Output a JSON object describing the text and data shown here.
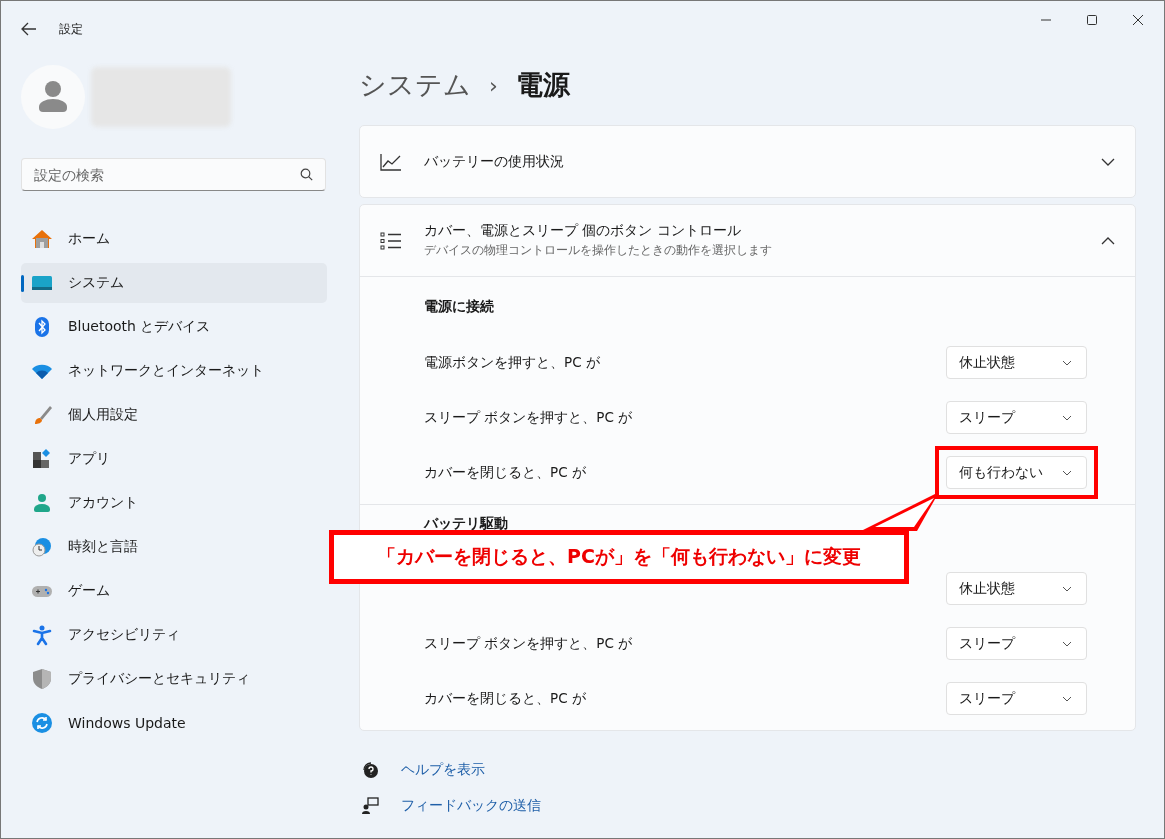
{
  "window": {
    "title": "設定"
  },
  "sidebar": {
    "search": {
      "placeholder": "設定の検索"
    },
    "items": [
      {
        "label": "ホーム",
        "kind": "home",
        "selected": false
      },
      {
        "label": "システム",
        "kind": "system",
        "selected": true
      },
      {
        "label": "Bluetooth とデバイス",
        "kind": "bluetooth",
        "selected": false
      },
      {
        "label": "ネットワークとインターネット",
        "kind": "network",
        "selected": false
      },
      {
        "label": "個人用設定",
        "kind": "brush",
        "selected": false
      },
      {
        "label": "アプリ",
        "kind": "apps",
        "selected": false
      },
      {
        "label": "アカウント",
        "kind": "account",
        "selected": false
      },
      {
        "label": "時刻と言語",
        "kind": "time",
        "selected": false
      },
      {
        "label": "ゲーム",
        "kind": "game",
        "selected": false
      },
      {
        "label": "アクセシビリティ",
        "kind": "access",
        "selected": false
      },
      {
        "label": "プライバシーとセキュリティ",
        "kind": "shield",
        "selected": false
      },
      {
        "label": "Windows Update",
        "kind": "update",
        "selected": false
      }
    ]
  },
  "breadcrumb": {
    "parent": "システム",
    "separator": "›",
    "current": "電源"
  },
  "cards": [
    {
      "title": "バッテリーの使用状況",
      "kind": "chart",
      "expanded": false
    },
    {
      "title": "カバー、電源とスリープ 個のボタン コントロール",
      "subtitle": "デバイスの物理コントロールを操作したときの動作を選択します",
      "kind": "list",
      "expanded": true,
      "sections": [
        {
          "heading": "電源に接続",
          "rows": [
            {
              "label": "電源ボタンを押すと、PC が",
              "value": "休止状態",
              "highlighted": false
            },
            {
              "label": "スリープ ボタンを押すと、PC が",
              "value": "スリープ",
              "highlighted": false
            },
            {
              "label": "カバーを閉じると、PC が",
              "value": "何も行わない",
              "highlighted": true
            }
          ]
        },
        {
          "heading": "バッテリ駆動",
          "rows": [
            {
              "value": "休止状態",
              "highlighted": false
            },
            {
              "label": "スリープ ボタンを押すと、PC が",
              "value": "スリープ",
              "highlighted": false
            },
            {
              "label": "カバーを閉じると、PC が",
              "value": "スリープ",
              "highlighted": false
            }
          ]
        }
      ]
    }
  ],
  "links": [
    {
      "label": "ヘルプを表示",
      "kind": "help"
    },
    {
      "label": "フィードバックの送信",
      "kind": "feedback"
    }
  ],
  "callout": {
    "text": "「カバーを閉じると、PCが」を「何も行わない」に変更"
  }
}
